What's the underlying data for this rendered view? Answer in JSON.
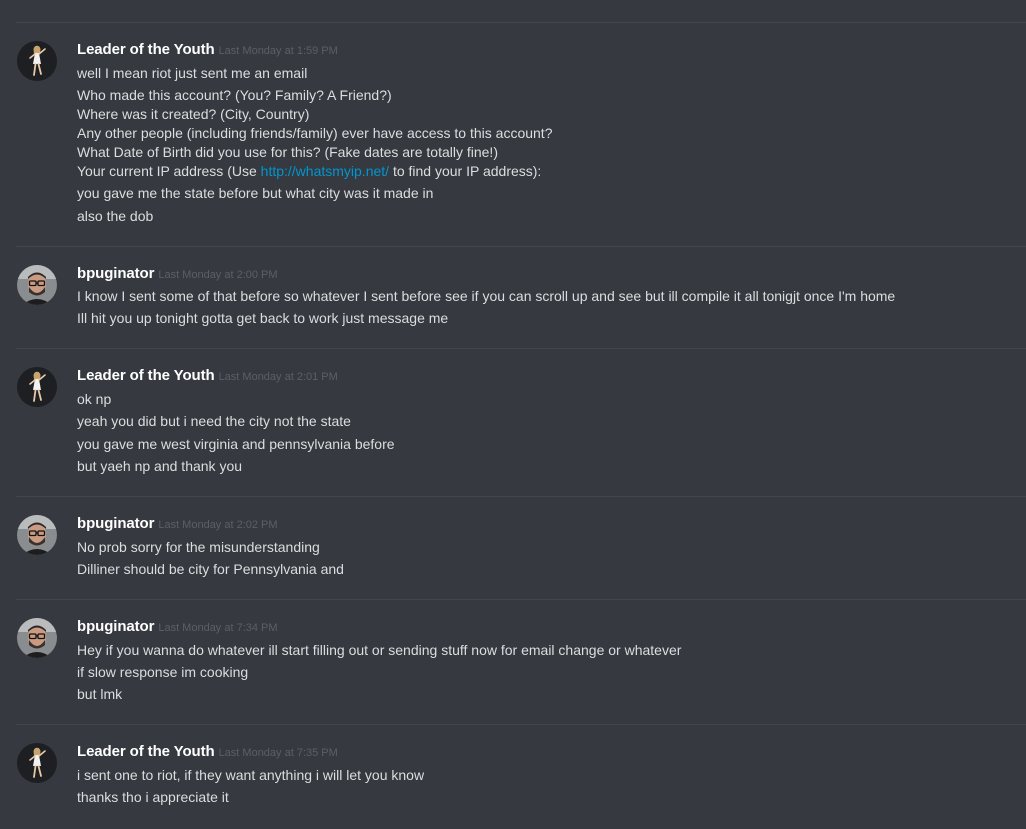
{
  "partial_top_line": "",
  "link_color": "#0096cf",
  "groups": [
    {
      "author": "Leader of the Youth",
      "timestamp": "Last Monday at 1:59 PM",
      "avatar_icon": "dancer-avatar",
      "lines": [
        "well I mean riot just sent me an email",
        "Who made this account? (You? Family? A Friend?)",
        "Where was it created? (City, Country)",
        "Any other people (including friends/family) ever have access to this account?",
        "What Date of Birth did you use for this? (Fake dates are totally fine!)",
        "Your current IP address (Use ",
        "you gave me the state before but what city was it made in",
        "also the dob"
      ],
      "ip_link": "http://whatsmyip.net/",
      "ip_suffix": " to find your IP address):"
    },
    {
      "author": "bpuginator",
      "timestamp": "Last Monday at 2:00 PM",
      "avatar_icon": "man-with-glasses-avatar",
      "lines": [
        "I know I sent some of that before so whatever I sent before see if you can scroll up and see but ill compile it all tonigjt once I'm home",
        "Ill hit you up tonight gotta get back to work just message me"
      ]
    },
    {
      "author": "Leader of the Youth",
      "timestamp": "Last Monday at 2:01 PM",
      "avatar_icon": "dancer-avatar",
      "lines": [
        "ok np",
        "yeah you did but i need the city not the state",
        "you gave me west virginia and pennsylvania before",
        "but yaeh np and thank you"
      ]
    },
    {
      "author": "bpuginator",
      "timestamp": "Last Monday at 2:02 PM",
      "avatar_icon": "man-with-glasses-avatar",
      "lines": [
        "No prob sorry for the misunderstanding",
        "Dilliner should be city for Pennsylvania and"
      ]
    },
    {
      "author": "bpuginator",
      "timestamp": "Last Monday at 7:34 PM",
      "avatar_icon": "man-with-glasses-avatar",
      "lines": [
        "Hey if you wanna do whatever ill start filling out or sending stuff now for email change or whatever",
        "if slow response im cooking",
        "but lmk"
      ]
    },
    {
      "author": "Leader of the Youth",
      "timestamp": "Last Monday at 7:35 PM",
      "avatar_icon": "dancer-avatar",
      "lines": [
        "i sent one to riot,  if they want anything i will let you know",
        "thanks tho i appreciate it"
      ]
    }
  ]
}
